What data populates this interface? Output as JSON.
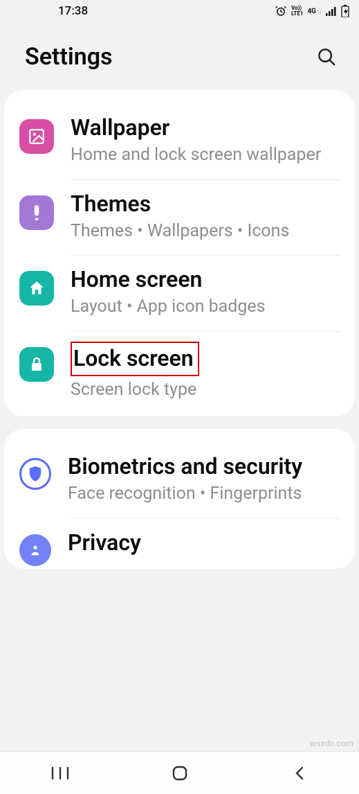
{
  "status": {
    "time": "17:38",
    "indicators": {
      "volte": "Vo))\nLTE1",
      "net": "4G"
    }
  },
  "header": {
    "title": "Settings"
  },
  "groups": [
    {
      "items": [
        {
          "key": "wallpaper",
          "title": "Wallpaper",
          "subtitle": "Home and lock screen wallpaper",
          "color": "#d74ea5",
          "highlighted": false
        },
        {
          "key": "themes",
          "title": "Themes",
          "subtitle": "Themes  •  Wallpapers  •  Icons",
          "color": "#a278d6",
          "highlighted": false
        },
        {
          "key": "home-screen",
          "title": "Home screen",
          "subtitle": "Layout  •  App icon badges",
          "color": "#15b6a6",
          "highlighted": false
        },
        {
          "key": "lock-screen",
          "title": "Lock screen",
          "subtitle": "Screen lock type",
          "color": "#15b6a6",
          "highlighted": true
        }
      ]
    },
    {
      "items": [
        {
          "key": "biometrics",
          "title": "Biometrics and security",
          "subtitle": "Face recognition  •  Fingerprints",
          "color": "#5b6df7",
          "highlighted": false
        },
        {
          "key": "privacy",
          "title": "Privacy",
          "subtitle": "",
          "color": "#5b6df7",
          "highlighted": false
        }
      ]
    }
  ],
  "watermark": "wsxdn.com"
}
